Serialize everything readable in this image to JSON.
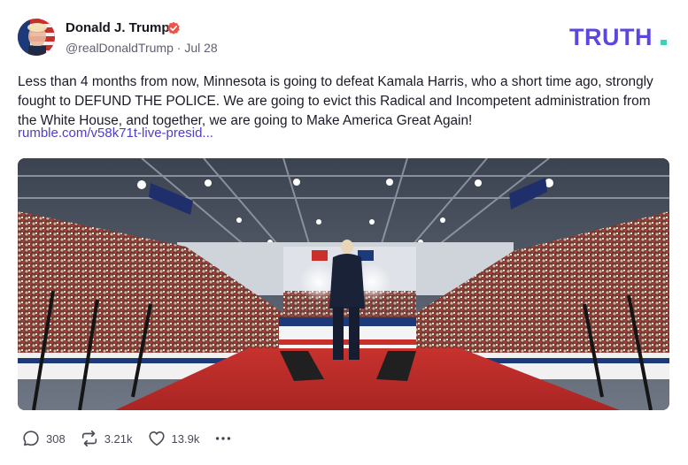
{
  "author": {
    "display_name": "Donald J. Trump",
    "handle": "@realDonaldTrump",
    "separator": "·",
    "date": "Jul 28",
    "verified_icon": "verified-badge-icon"
  },
  "brand": {
    "logo_text": "TRUTH.",
    "logo_color": "#5b46e0",
    "dot_color": "#3ed1b7"
  },
  "post": {
    "text": "Less than 4 months from now, Minnesota is going to defeat Kamala Harris, who a short time ago, strongly fought to DEFUND THE POLICE. We are going to evict this Radical and Incompetent administration from the White House, and together, we are going to Make America Great Again!",
    "link_text": "rumble.com/v58k71t-live-presid..."
  },
  "actions": {
    "replies": "308",
    "retruths": "3.21k",
    "likes": "13.9k",
    "icons": [
      "reply-icon",
      "retruth-icon",
      "like-icon",
      "more-icon"
    ]
  },
  "colors": {
    "accent_link": "#4f3ec6",
    "verified": "#e8544c",
    "text": "#1b1b28",
    "muted": "#606070"
  }
}
